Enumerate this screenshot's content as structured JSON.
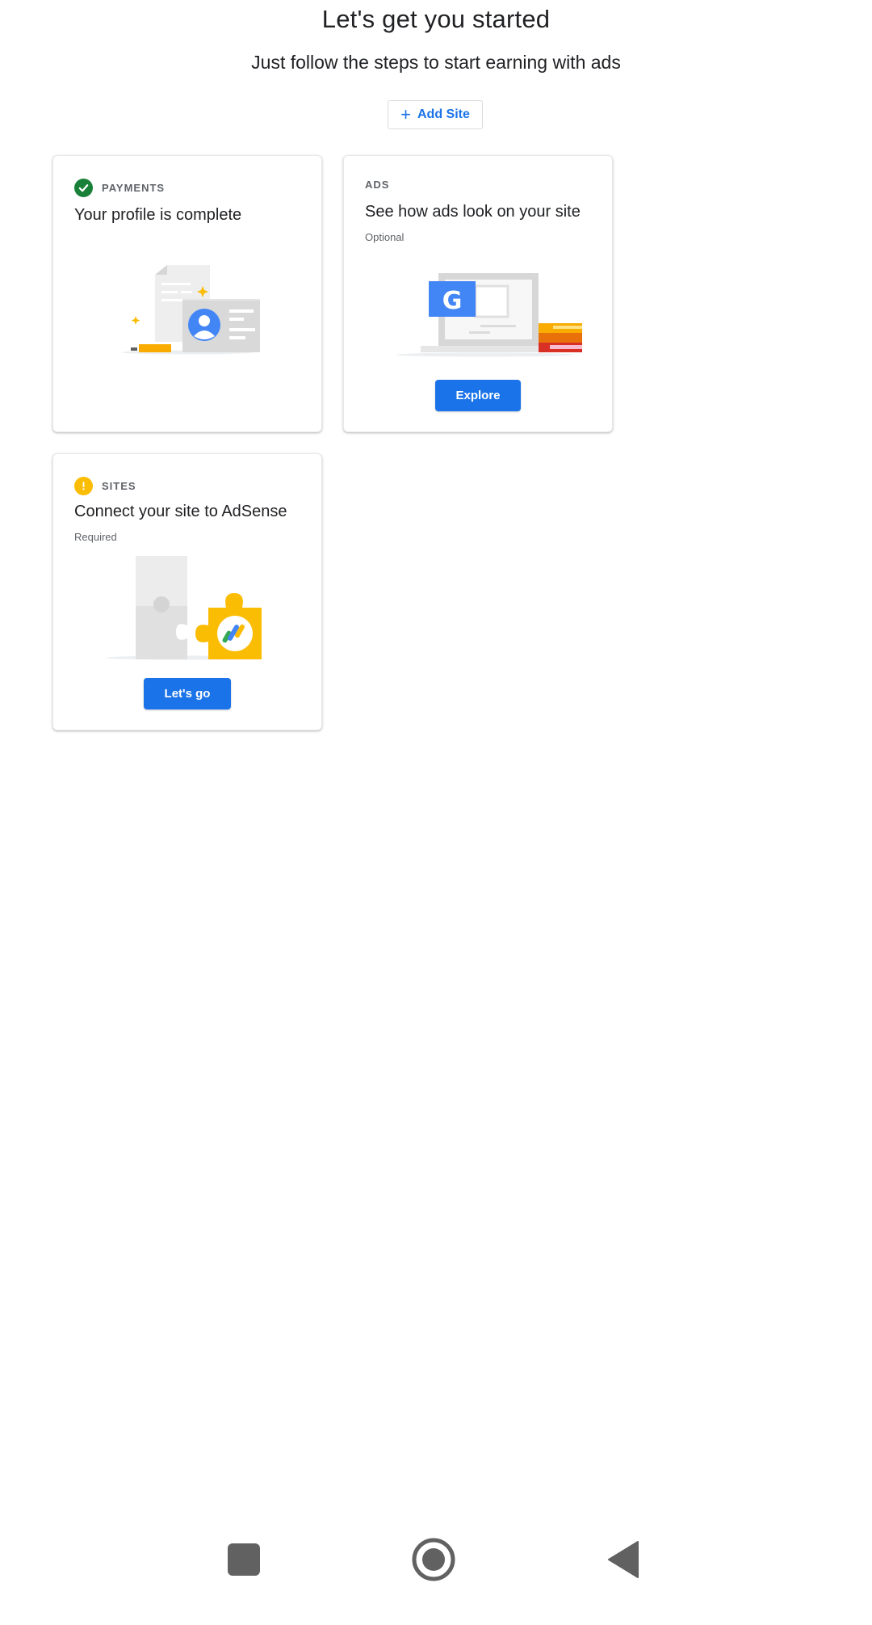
{
  "header": {
    "title": "Let's get you started",
    "subtitle": "Just follow the steps to start earning with ads",
    "add_site_label": "Add Site",
    "add_site_icon": "plus-icon"
  },
  "cards": [
    {
      "category": "PAYMENTS",
      "status": "complete",
      "status_icon": "check-circle-icon",
      "status_color": "#188038",
      "title": "Your profile is complete",
      "illustration": "profile-card-illustration"
    },
    {
      "category": "ADS",
      "title": "See how ads look on your site",
      "note": "Optional",
      "button_label": "Explore",
      "illustration": "laptop-google-illustration"
    },
    {
      "category": "SITES",
      "status": "warning",
      "status_icon": "exclamation-circle-icon",
      "status_color": "#fbbc04",
      "title": "Connect your site to AdSense",
      "note": "Required",
      "button_label": "Let's go",
      "illustration": "puzzle-adsense-illustration"
    }
  ],
  "colors": {
    "accent": "#1a73e8",
    "success": "#188038",
    "warning": "#fbbc04"
  },
  "navigation_bar": {
    "buttons": [
      "square-recents-icon",
      "circle-home-icon",
      "triangle-back-icon"
    ]
  }
}
